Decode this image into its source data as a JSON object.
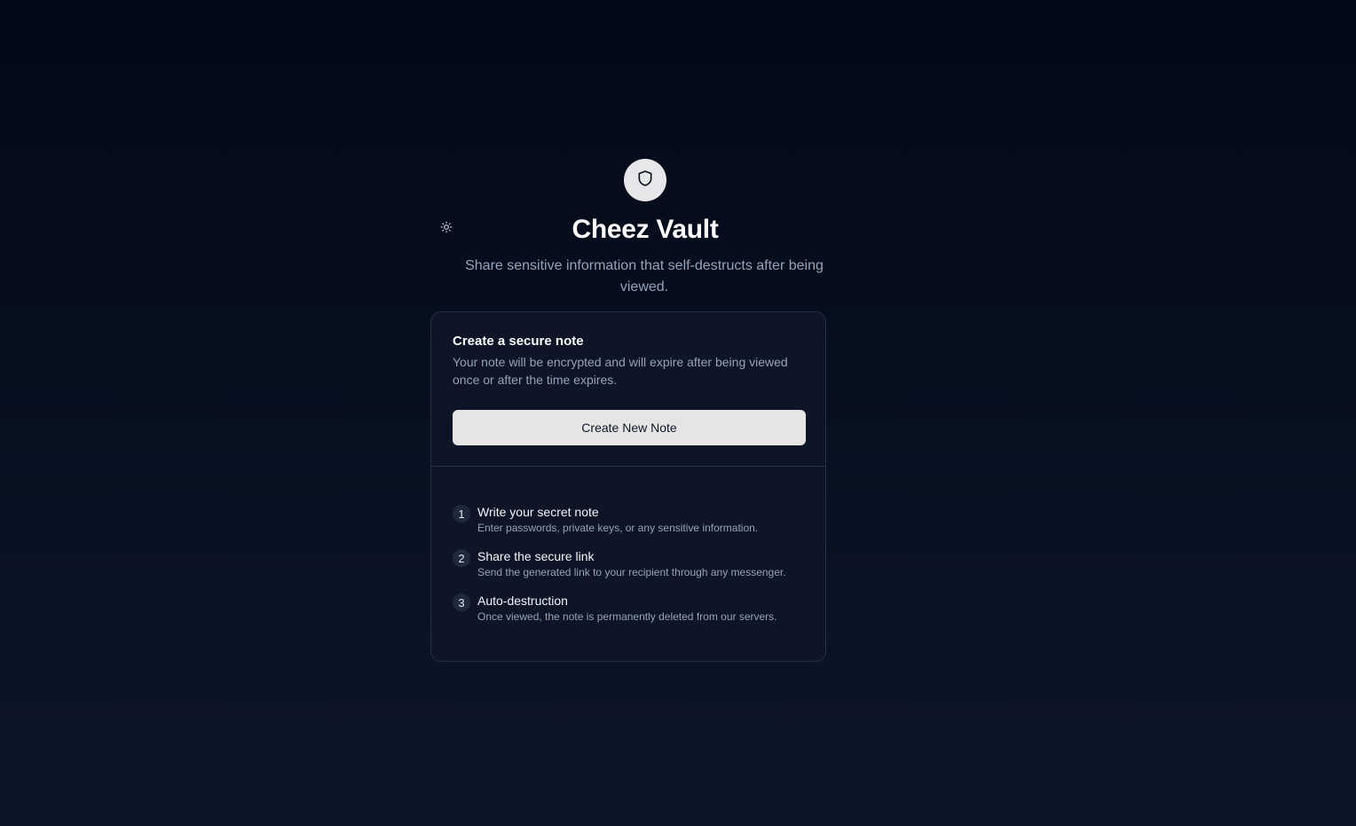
{
  "header": {
    "title": "Cheez Vault",
    "subtitle": "Share sensitive information that self-destructs after being viewed.",
    "logo_icon": "shield-icon",
    "theme_icon": "sun-icon"
  },
  "card": {
    "title": "Create a secure note",
    "description": "Your note will be encrypted and will expire after being viewed once or after the time expires.",
    "button_label": "Create New Note",
    "steps": [
      {
        "number": "1",
        "title": "Write your secret note",
        "description": "Enter passwords, private keys, or any sensitive information."
      },
      {
        "number": "2",
        "title": "Share the secure link",
        "description": "Send the generated link to your recipient through any messenger."
      },
      {
        "number": "3",
        "title": "Auto-destruction",
        "description": "Once viewed, the note is permanently deleted from our servers."
      }
    ]
  },
  "colors": {
    "background": "#030816",
    "card": "#0d1526",
    "border": "#243047",
    "muted_text": "#94a3b8",
    "button": "#e5e5e5"
  }
}
